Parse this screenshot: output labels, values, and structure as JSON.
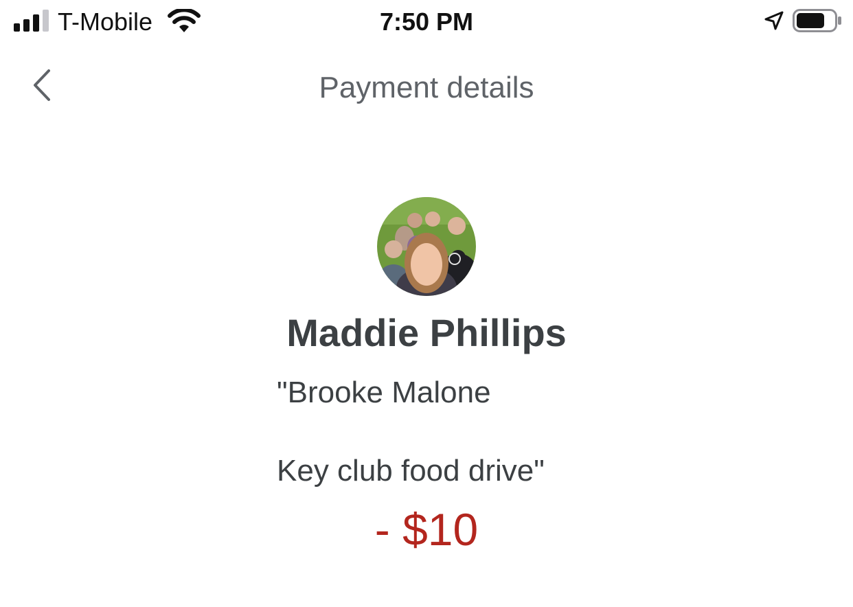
{
  "status_bar": {
    "carrier": "T-Mobile",
    "time": "7:50 PM",
    "signal_bars": 3,
    "signal_bars_total": 4,
    "battery_level": 0.75
  },
  "header": {
    "title": "Payment details",
    "back_icon": "chevron-left-icon"
  },
  "payment": {
    "payee_name": "Maddie Phillips",
    "note_line1": "\"Brooke Malone",
    "note_line2": "Key club food drive\"",
    "amount": "- $10"
  },
  "colors": {
    "amount": "#b3261e",
    "title": "#5f6368",
    "text": "#3c4043"
  }
}
